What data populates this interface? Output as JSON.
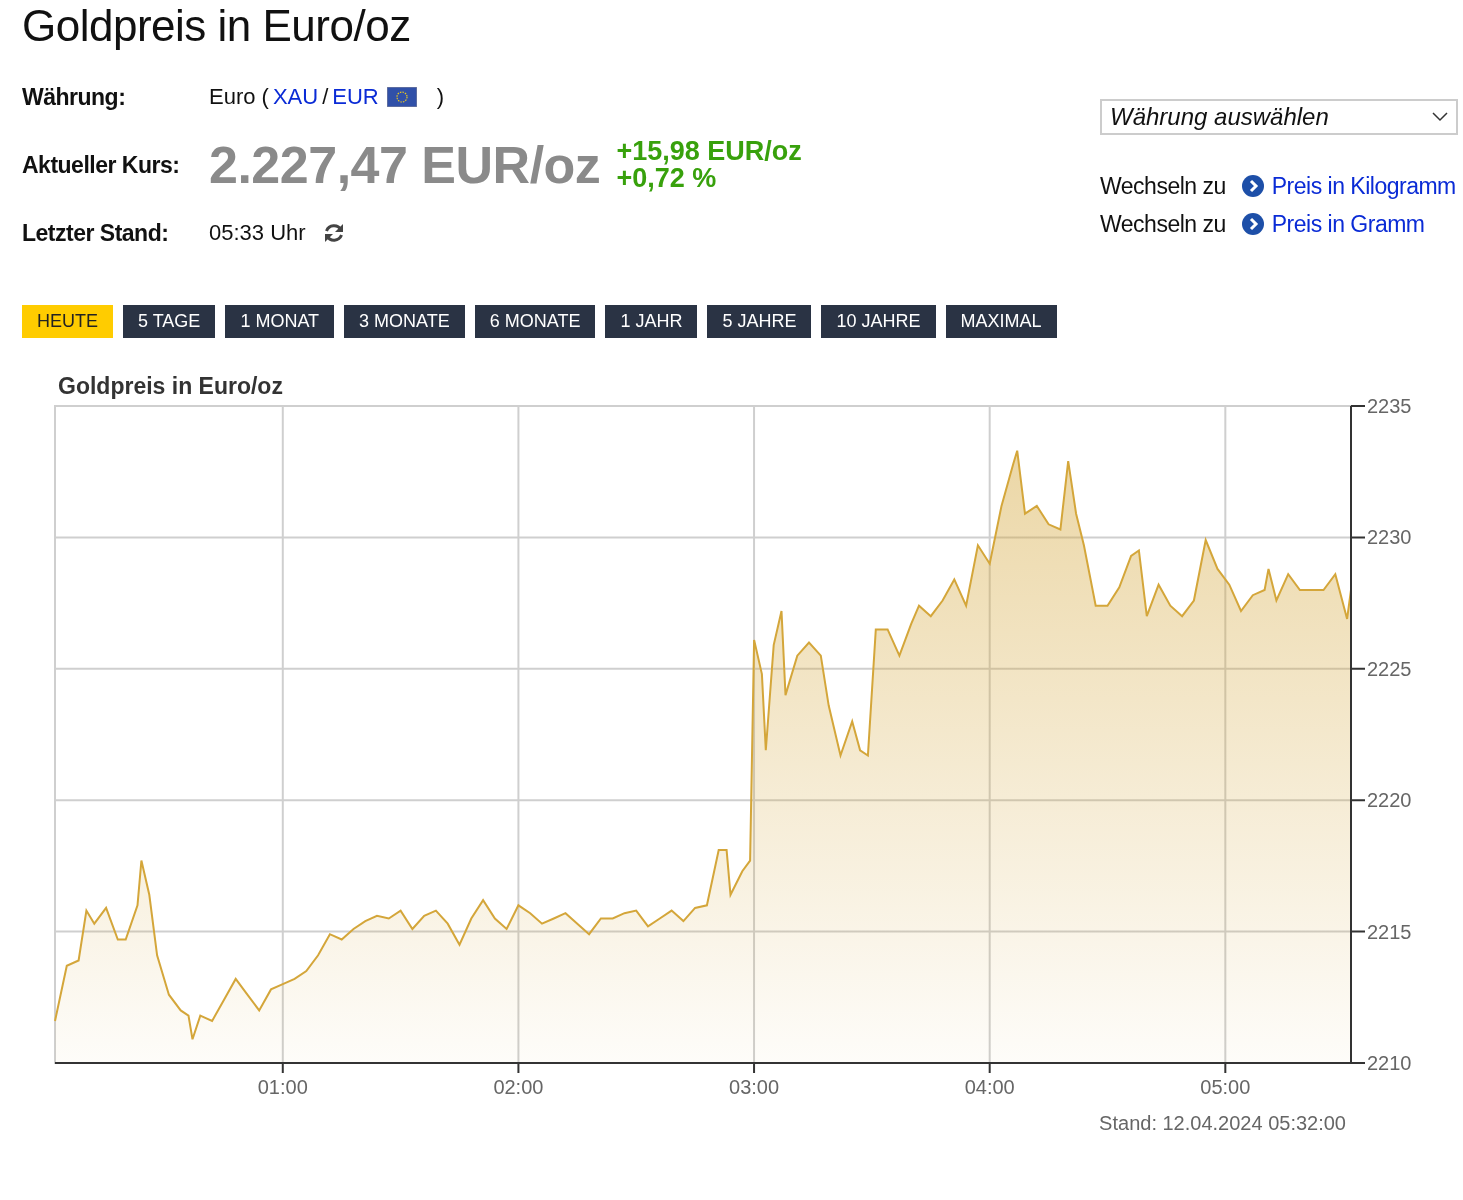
{
  "title": "Goldpreis in Euro/oz",
  "currency": {
    "label": "Währung:",
    "name": "Euro (",
    "link_1": "XAU",
    "separator": "/",
    "link_2": "EUR",
    "close": ")"
  },
  "price": {
    "label": "Aktueller Kurs:",
    "value": "2.227,47 EUR/oz",
    "change_abs": "+15,98 EUR/oz",
    "change_pct": "+0,72 %"
  },
  "updated": {
    "label": "Letzter Stand:",
    "time": "05:33 Uhr"
  },
  "currency_select": {
    "value": "Währung auswählen"
  },
  "switch_links": [
    {
      "prefix": "Wechseln zu",
      "link": "Preis in Kilogramm"
    },
    {
      "prefix": "Wechseln zu",
      "link": "Preis in Gramm"
    }
  ],
  "ranges": [
    {
      "label": "HEUTE",
      "selected": true
    },
    {
      "label": "5 TAGE",
      "selected": false
    },
    {
      "label": "1 MONAT",
      "selected": false
    },
    {
      "label": "3 MONATE",
      "selected": false
    },
    {
      "label": "6 MONATE",
      "selected": false
    },
    {
      "label": "1 JAHR",
      "selected": false
    },
    {
      "label": "5 JAHRE",
      "selected": false
    },
    {
      "label": "10 JAHRE",
      "selected": false
    },
    {
      "label": "MAXIMAL",
      "selected": false
    }
  ],
  "chart": {
    "footer": "Stand: 12.04.2024 05:32:00",
    "chart_data": {
      "type": "area",
      "title": "Goldpreis in Euro/oz",
      "x": [
        2,
        5,
        8,
        10,
        12,
        15,
        18,
        20,
        23,
        24,
        26,
        28,
        31,
        34,
        36,
        37,
        39,
        42,
        45,
        48,
        51,
        54,
        57,
        60,
        63,
        66,
        69,
        72,
        75,
        78,
        81,
        84,
        87,
        90,
        93,
        96,
        99,
        102,
        105,
        108,
        111,
        114,
        117,
        120,
        123,
        126,
        129,
        132,
        135,
        138,
        141,
        144,
        147,
        150,
        153,
        156,
        159,
        162,
        165,
        168,
        171,
        173,
        174,
        177,
        179,
        180,
        182,
        183,
        185,
        187,
        188,
        191,
        194,
        197,
        199,
        202,
        205,
        207,
        209,
        211,
        214,
        217,
        220,
        222,
        225,
        228,
        231,
        234,
        237,
        240,
        243,
        246,
        247,
        249,
        252,
        255,
        258,
        260,
        262,
        264,
        267,
        270,
        273,
        276,
        278,
        280,
        283,
        286,
        289,
        292,
        295,
        298,
        301,
        304,
        307,
        310,
        311,
        313,
        316,
        319,
        322,
        325,
        328,
        331,
        332
      ],
      "grid": true,
      "series": [
        {
          "color": "#d4a63a",
          "values": [
            2211.6,
            2213.7,
            2213.9,
            2215.8,
            2215.3,
            2215.9,
            2214.7,
            2214.7,
            2216.0,
            2217.7,
            2216.4,
            2214.1,
            2212.6,
            2212.0,
            2211.8,
            2210.9,
            2211.8,
            2211.6,
            2212.4,
            2213.2,
            2212.6,
            2212.0,
            2212.8,
            2213.0,
            2213.2,
            2213.5,
            2214.1,
            2214.9,
            2214.7,
            2215.1,
            2215.4,
            2215.6,
            2215.5,
            2215.8,
            2215.1,
            2215.6,
            2215.8,
            2215.3,
            2214.5,
            2215.5,
            2216.2,
            2215.5,
            2215.1,
            2216.0,
            2215.7,
            2215.3,
            2215.5,
            2215.7,
            2215.3,
            2214.9,
            2215.5,
            2215.5,
            2215.7,
            2215.8,
            2215.2,
            2215.5,
            2215.8,
            2215.4,
            2215.9,
            2216.0,
            2218.1,
            2218.1,
            2216.4,
            2217.3,
            2217.7,
            2226.1,
            2224.8,
            2221.9,
            2225.9,
            2227.2,
            2224.0,
            2225.5,
            2226.0,
            2225.5,
            2223.6,
            2221.7,
            2223.0,
            2221.9,
            2221.7,
            2226.5,
            2226.5,
            2225.5,
            2226.7,
            2227.4,
            2227.0,
            2227.6,
            2228.4,
            2227.4,
            2229.7,
            2229.0,
            2231.2,
            2232.8,
            2233.3,
            2230.9,
            2231.2,
            2230.5,
            2230.3,
            2232.9,
            2230.9,
            2229.7,
            2227.4,
            2227.4,
            2228.1,
            2229.3,
            2229.5,
            2227.0,
            2228.2,
            2227.4,
            2227.0,
            2227.6,
            2229.9,
            2228.8,
            2228.2,
            2227.2,
            2227.8,
            2228.0,
            2228.8,
            2227.6,
            2228.6,
            2228.0,
            2228.0,
            2228.0,
            2228.6,
            2226.9,
            2228.0
          ]
        }
      ],
      "xlim": [
        2,
        332
      ],
      "ylim": [
        2210,
        2235
      ],
      "xticks": [
        {
          "value": 60,
          "label": "01:00"
        },
        {
          "value": 120,
          "label": "02:00"
        },
        {
          "value": 180,
          "label": "03:00"
        },
        {
          "value": 240,
          "label": "04:00"
        },
        {
          "value": 300,
          "label": "05:00"
        }
      ],
      "yticks": [
        2210,
        2215,
        2220,
        2225,
        2230,
        2235
      ]
    }
  }
}
